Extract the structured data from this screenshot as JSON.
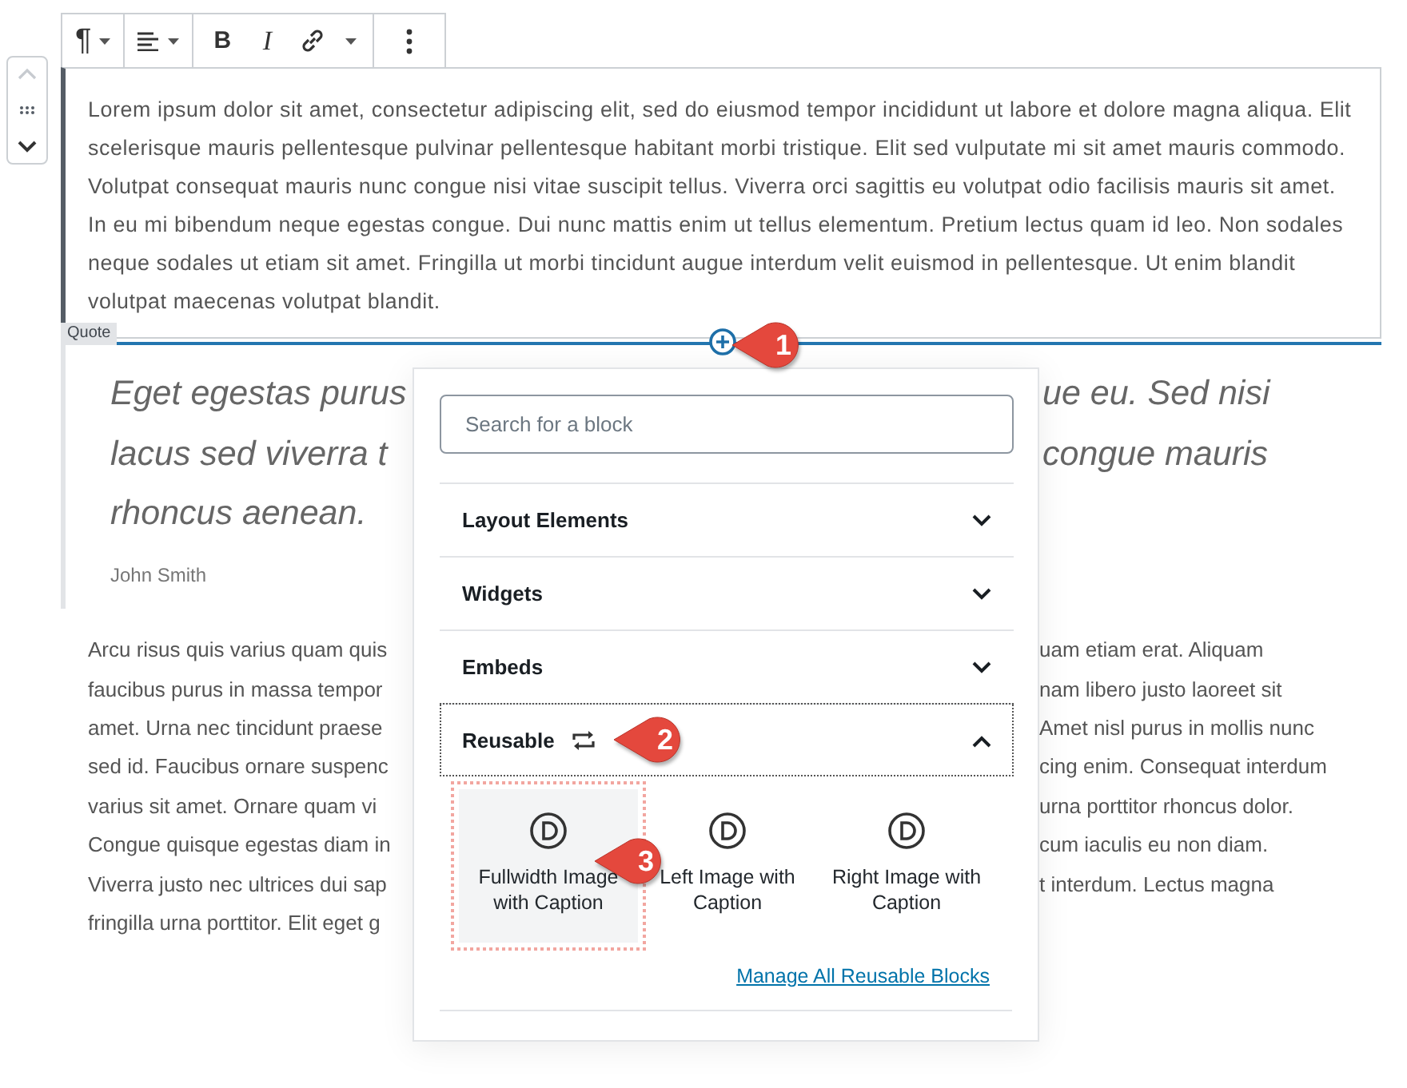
{
  "toolbar": [
    {
      "items": [
        {
          "kind": "paragraph",
          "label": "¶",
          "caret": true
        }
      ]
    },
    {
      "items": [
        {
          "kind": "align",
          "caret": true
        }
      ]
    },
    {
      "items": [
        {
          "kind": "bold",
          "label": "B"
        },
        {
          "kind": "italic",
          "label": "I"
        },
        {
          "kind": "link"
        },
        {
          "kind": "dropdown"
        }
      ]
    },
    {
      "items": [
        {
          "kind": "more"
        }
      ]
    }
  ],
  "paragraph_1": "Lorem ipsum dolor sit amet, consectetur adipiscing elit, sed do eiusmod tempor incididunt ut labore et dolore magna aliqua. Elit scelerisque mauris pellentesque pulvinar pellentesque habitant morbi tristique. Elit sed vulputate mi sit amet mauris commodo. Volutpat consequat mauris nunc congue nisi vitae suscipit tellus. Viverra orci sagittis eu volutpat odio facilisis mauris sit amet. In eu mi bibendum neque egestas congue. Dui nunc mattis enim ut tellus elementum. Pretium lectus quam id leo. Non sodales neque sodales ut etiam sit amet. Fringilla ut morbi tincidunt augue interdum velit euismod in pellentesque. Ut enim blandit volutpat maecenas volutpat blandit.",
  "block_label": "Quote",
  "quote": {
    "lines": [
      {
        "left": "Eget egestas purus",
        "right": "ue eu. Sed nisi"
      },
      {
        "left": "lacus sed viverra t",
        "right": "congue mauris"
      },
      {
        "left": "rhoncus aenean."
      }
    ],
    "citation": "John Smith"
  },
  "paragraph_2": {
    "lines": [
      {
        "left": "Arcu risus quis varius quam quis",
        "right": "uam etiam erat. Aliquam"
      },
      {
        "left": "faucibus purus in massa tempor",
        "right": "nam libero justo laoreet sit"
      },
      {
        "left": "amet. Urna nec tincidunt praese",
        "right": "Amet nisl purus in mollis nunc"
      },
      {
        "left": "sed id. Faucibus ornare suspenc",
        "right": "cing enim. Consequat interdum"
      },
      {
        "left": "varius sit amet. Ornare quam vi",
        "right": "urna porttitor rhoncus dolor."
      },
      {
        "left": "Congue quisque egestas diam in",
        "right": "cum iaculis eu non diam."
      },
      {
        "left": "Viverra justo nec ultrices dui sap",
        "right": "t interdum. Lectus magna"
      },
      {
        "left": "fringilla urna porttitor. Elit eget g"
      }
    ]
  },
  "inserter": {
    "search": {
      "placeholder": "Search for a block"
    },
    "categories": [
      {
        "label": "Layout Elements",
        "kind": "plain",
        "expanded": false,
        "focused": false
      },
      {
        "label": "Widgets",
        "kind": "plain",
        "expanded": false,
        "focused": false
      },
      {
        "label": "Embeds",
        "kind": "plain",
        "expanded": false,
        "focused": false
      },
      {
        "label": "Reusable",
        "kind": "reusable",
        "expanded": true,
        "focused": true
      }
    ],
    "reusable_blocks": [
      {
        "label": "Fullwidth Image with Caption",
        "selected": true
      },
      {
        "label": "Left Image with Caption",
        "selected": false
      },
      {
        "label": "Right Image with Caption",
        "selected": false
      }
    ],
    "manage_link": "Manage All Reusable Blocks"
  },
  "callouts": [
    {
      "label": "1"
    },
    {
      "label": "2"
    },
    {
      "label": "3"
    }
  ]
}
